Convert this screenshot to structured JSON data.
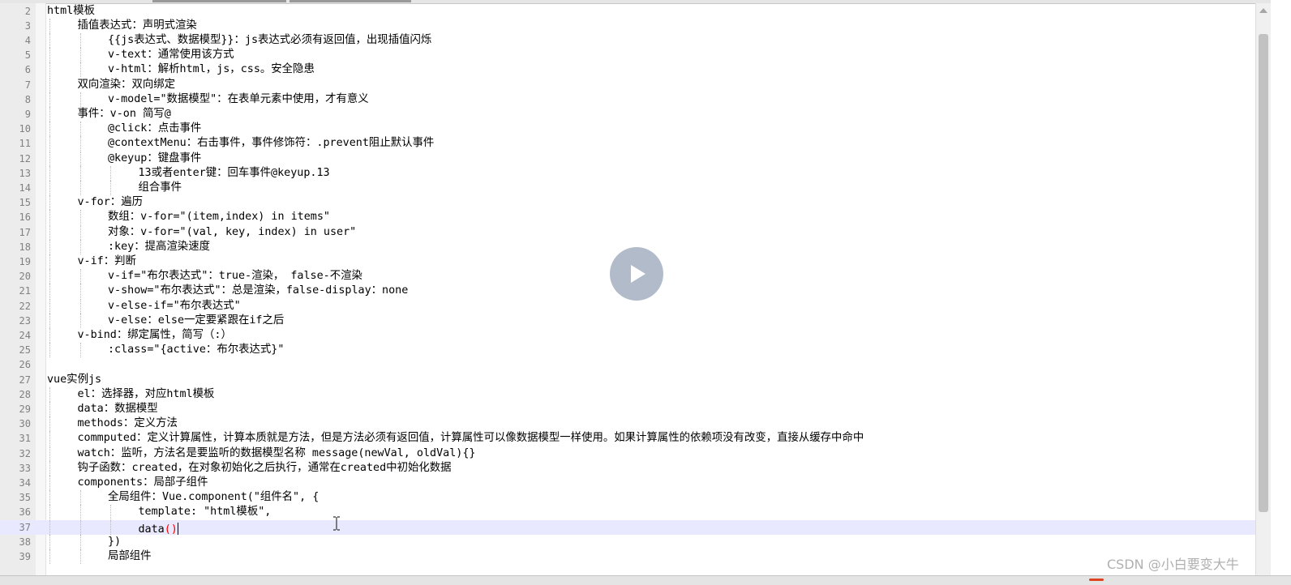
{
  "editor": {
    "lines": [
      {
        "n": "2",
        "text": "html模板",
        "indent": 0
      },
      {
        "n": "3",
        "text": "插值表达式：声明式渲染",
        "indent": 1
      },
      {
        "n": "4",
        "text": "{{js表达式、数据模型}}：js表达式必须有返回值，出现插值闪烁",
        "indent": 2
      },
      {
        "n": "5",
        "text": "v-text：通常使用该方式",
        "indent": 2
      },
      {
        "n": "6",
        "text": "v-html：解析html，js，css。安全隐患",
        "indent": 2
      },
      {
        "n": "7",
        "text": "双向渲染：双向绑定",
        "indent": 1
      },
      {
        "n": "8",
        "text": "v-model=\"数据模型\"：在表单元素中使用，才有意义",
        "indent": 2
      },
      {
        "n": "9",
        "text": "事件：v-on 简写@",
        "indent": 1
      },
      {
        "n": "10",
        "text": "@click：点击事件",
        "indent": 2
      },
      {
        "n": "11",
        "text": "@contextMenu：右击事件，事件修饰符：.prevent阻止默认事件",
        "indent": 2
      },
      {
        "n": "12",
        "text": "@keyup：键盘事件",
        "indent": 2
      },
      {
        "n": "13",
        "text": "13或者enter键：回车事件@keyup.13",
        "indent": 3
      },
      {
        "n": "14",
        "text": "组合事件",
        "indent": 3
      },
      {
        "n": "15",
        "text": "v-for：遍历",
        "indent": 1
      },
      {
        "n": "16",
        "text": "数组：v-for=\"(item,index) in items\"",
        "indent": 2
      },
      {
        "n": "17",
        "text": "对象：v-for=\"(val, key, index) in user\"",
        "indent": 2
      },
      {
        "n": "18",
        "text": ":key：提高渲染速度",
        "indent": 2
      },
      {
        "n": "19",
        "text": "v-if：判断",
        "indent": 1
      },
      {
        "n": "20",
        "text": "v-if=\"布尔表达式\"：true-渲染， false-不渲染",
        "indent": 2
      },
      {
        "n": "21",
        "text": "v-show=\"布尔表达式\"：总是渲染，false-display：none",
        "indent": 2
      },
      {
        "n": "22",
        "text": "v-else-if=\"布尔表达式\"",
        "indent": 2
      },
      {
        "n": "23",
        "text": "v-else：else一定要紧跟在if之后",
        "indent": 2
      },
      {
        "n": "24",
        "text": "v-bind：绑定属性，简写（:）",
        "indent": 1
      },
      {
        "n": "25",
        "text": ":class=\"{active：布尔表达式}\"",
        "indent": 2
      },
      {
        "n": "26",
        "text": "",
        "indent": 0
      },
      {
        "n": "27",
        "text": "vue实例js",
        "indent": 0
      },
      {
        "n": "28",
        "text": "el：选择器，对应html模板",
        "indent": 1
      },
      {
        "n": "29",
        "text": "data：数据模型",
        "indent": 1
      },
      {
        "n": "30",
        "text": "methods：定义方法",
        "indent": 1
      },
      {
        "n": "31",
        "text": "commputed：定义计算属性，计算本质就是方法，但是方法必须有返回值，计算属性可以像数据模型一样使用。如果计算属性的依赖项没有改变，直接从缓存中命中",
        "indent": 1
      },
      {
        "n": "32",
        "text": "watch：监听，方法名是要监听的数据模型名称 message(newVal, oldVal){}",
        "indent": 1
      },
      {
        "n": "33",
        "text": "钩子函数：created，在对象初始化之后执行，通常在created中初始化数据",
        "indent": 1
      },
      {
        "n": "34",
        "text": "components：局部子组件",
        "indent": 1
      },
      {
        "n": "35",
        "text": "全局组件：Vue.component(\"组件名\", {",
        "indent": 2
      },
      {
        "n": "36",
        "text": "template: \"html模板\",",
        "indent": 3
      },
      {
        "n": "37",
        "text": "data",
        "indent": 3,
        "current": true,
        "suffix": "()"
      },
      {
        "n": "38",
        "text": "})",
        "indent": 2
      },
      {
        "n": "39",
        "text": "局部组件",
        "indent": 2
      }
    ]
  },
  "overlay": {
    "watermark": "CSDN @小白要变大牛"
  },
  "icons": {
    "play": "play-icon",
    "cursor": "text-cursor-icon"
  },
  "colors": {
    "current_line": "#e8e8ff",
    "bracket_match": "#ff0000",
    "line_number": "#808080"
  }
}
